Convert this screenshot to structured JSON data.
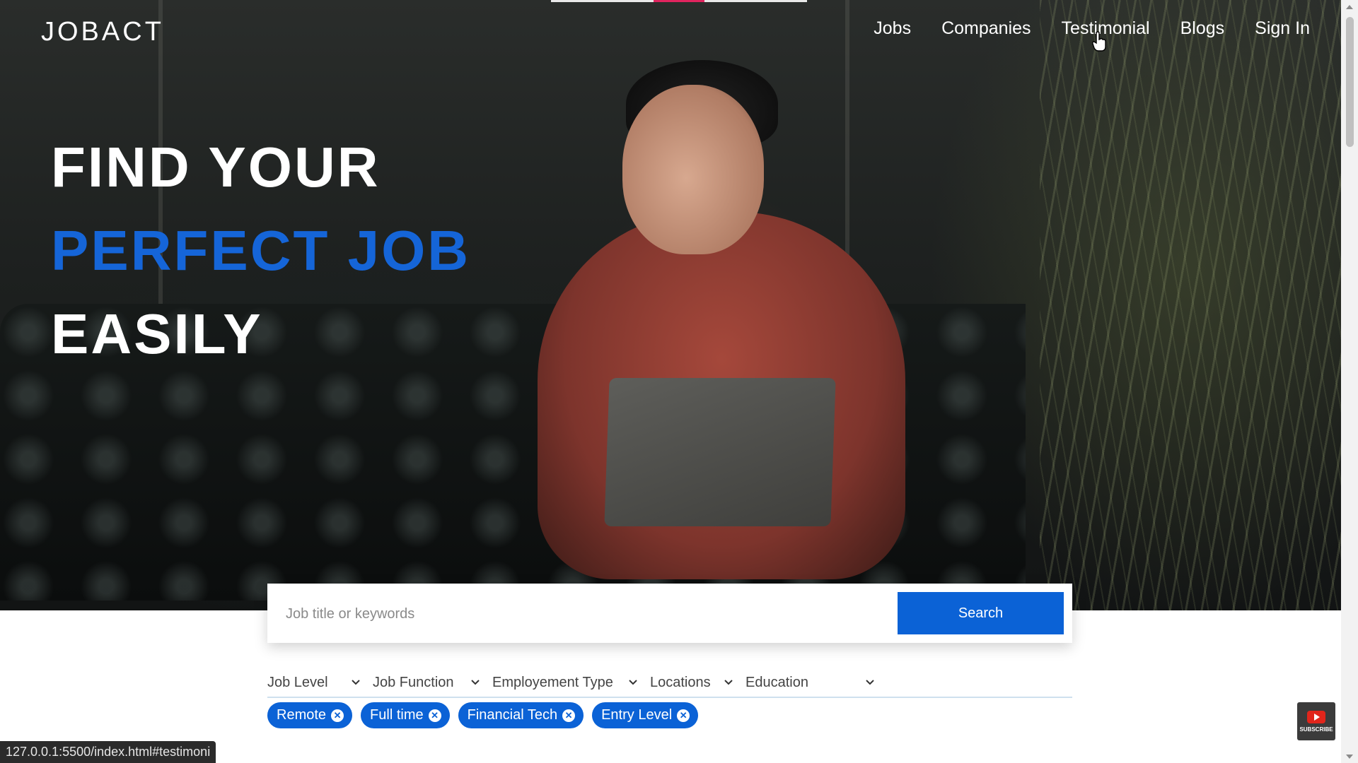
{
  "brand": {
    "logo": "JOBACT"
  },
  "nav": {
    "items": [
      "Jobs",
      "Companies",
      "Testimonial",
      "Blogs",
      "Sign In"
    ]
  },
  "hero": {
    "line1": "FIND YOUR",
    "line2": "PERFECT JOB",
    "line3": "EASILY"
  },
  "search": {
    "placeholder": "Job title or keywords",
    "value": "",
    "button": "Search"
  },
  "filters": [
    "Job Level",
    "Job Function",
    "Employement Type",
    "Locations",
    "Education"
  ],
  "chips": [
    "Remote",
    "Full time",
    "Financial Tech",
    "Entry Level"
  ],
  "status_bar": {
    "url": "127.0.0.1:5500/index.html#testimoni"
  },
  "subscribe_badge": {
    "label": "SUBSCRIBE"
  },
  "colors": {
    "accent": "#0b62d6",
    "headline_blue": "#1565d8",
    "progress_red": "#e0245e"
  }
}
